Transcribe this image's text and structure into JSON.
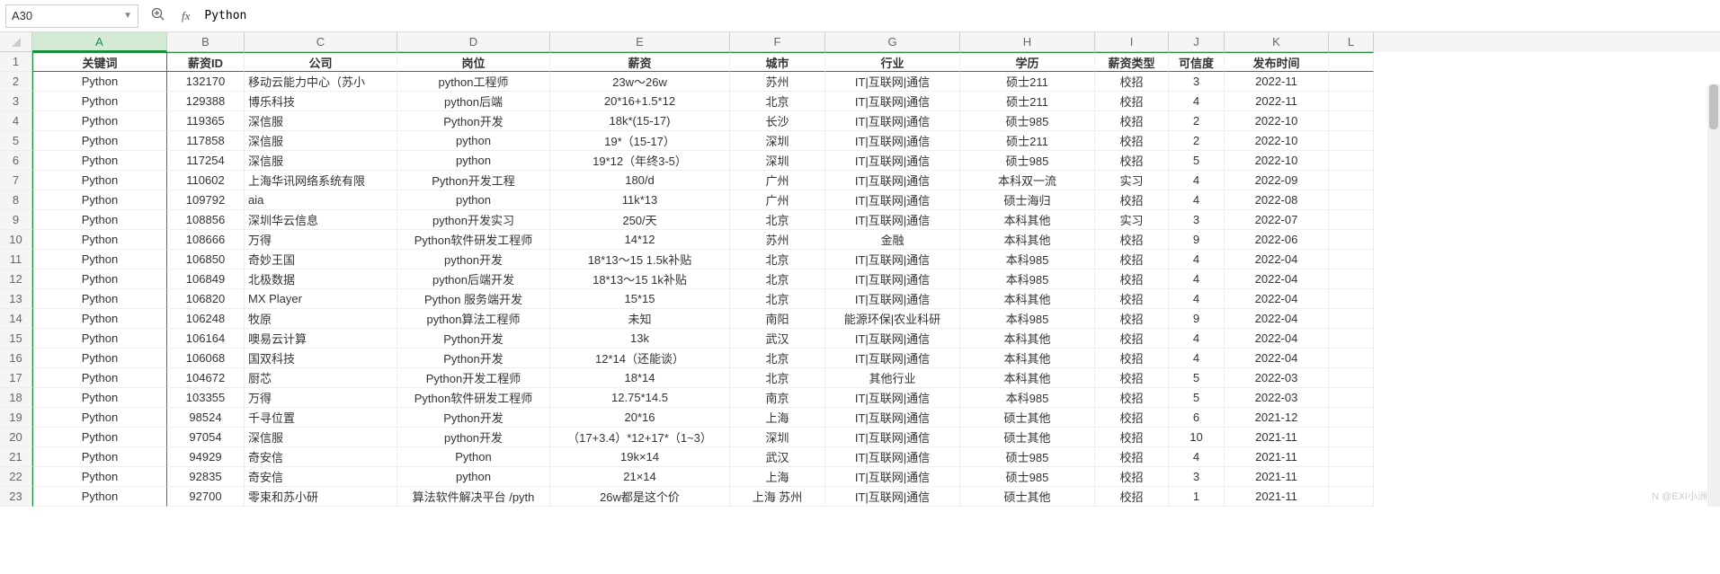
{
  "formula_bar": {
    "cell_ref": "A30",
    "value": "Python"
  },
  "col_letters": [
    "A",
    "B",
    "C",
    "D",
    "E",
    "F",
    "G",
    "H",
    "I",
    "J",
    "K",
    "L"
  ],
  "headers": {
    "A": "关键词",
    "B": "薪资ID",
    "C": "公司",
    "D": "岗位",
    "E": "薪资",
    "F": "城市",
    "G": "行业",
    "H": "学历",
    "I": "薪资类型",
    "J": "可信度",
    "K": "发布时间"
  },
  "rows": [
    {
      "A": "Python",
      "B": "132170",
      "C": "移动云能力中心（苏小",
      "D": "python工程师",
      "E": "23w～26w",
      "F": "苏州",
      "G": "IT|互联网|通信",
      "H": "硕士211",
      "I": "校招",
      "J": "3",
      "K": "2022-11"
    },
    {
      "A": "Python",
      "B": "129388",
      "C": "博乐科技",
      "D": "python后端",
      "E": "20*16+1.5*12",
      "F": "北京",
      "G": "IT|互联网|通信",
      "H": "硕士211",
      "I": "校招",
      "J": "4",
      "K": "2022-11"
    },
    {
      "A": "Python",
      "B": "119365",
      "C": "深信服",
      "D": "Python开发",
      "E": "18k*(15-17)",
      "F": "长沙",
      "G": "IT|互联网|通信",
      "H": "硕士985",
      "I": "校招",
      "J": "2",
      "K": "2022-10"
    },
    {
      "A": "Python",
      "B": "117858",
      "C": "深信服",
      "D": "python",
      "E": "19*（15-17）",
      "F": "深圳",
      "G": "IT|互联网|通信",
      "H": "硕士211",
      "I": "校招",
      "J": "2",
      "K": "2022-10"
    },
    {
      "A": "Python",
      "B": "117254",
      "C": "深信服",
      "D": "python",
      "E": "19*12（年终3-5）",
      "F": "深圳",
      "G": "IT|互联网|通信",
      "H": "硕士985",
      "I": "校招",
      "J": "5",
      "K": "2022-10"
    },
    {
      "A": "Python",
      "B": "110602",
      "C": "上海华讯网络系统有限",
      "D": "Python开发工程",
      "E": "180/d",
      "F": "广州",
      "G": "IT|互联网|通信",
      "H": "本科双一流",
      "I": "实习",
      "J": "4",
      "K": "2022-09"
    },
    {
      "A": "Python",
      "B": "109792",
      "C": "aia",
      "D": "python",
      "E": "11k*13",
      "F": "广州",
      "G": "IT|互联网|通信",
      "H": "硕士海归",
      "I": "校招",
      "J": "4",
      "K": "2022-08"
    },
    {
      "A": "Python",
      "B": "108856",
      "C": "深圳华云信息",
      "D": "python开发实习",
      "E": "250/天",
      "F": "北京",
      "G": "IT|互联网|通信",
      "H": "本科其他",
      "I": "实习",
      "J": "3",
      "K": "2022-07"
    },
    {
      "A": "Python",
      "B": "108666",
      "C": "万得",
      "D": "Python软件研发工程师",
      "E": "14*12",
      "F": "苏州",
      "G": "金融",
      "H": "本科其他",
      "I": "校招",
      "J": "9",
      "K": "2022-06"
    },
    {
      "A": "Python",
      "B": "106850",
      "C": "奇妙王国",
      "D": "python开发",
      "E": "18*13～15 1.5k补贴",
      "F": "北京",
      "G": "IT|互联网|通信",
      "H": "本科985",
      "I": "校招",
      "J": "4",
      "K": "2022-04"
    },
    {
      "A": "Python",
      "B": "106849",
      "C": "北极数据",
      "D": "python后端开发",
      "E": "18*13～15 1k补贴",
      "F": "北京",
      "G": "IT|互联网|通信",
      "H": "本科985",
      "I": "校招",
      "J": "4",
      "K": "2022-04"
    },
    {
      "A": "Python",
      "B": "106820",
      "C": "MX Player",
      "D": "Python 服务端开发",
      "E": "15*15",
      "F": "北京",
      "G": "IT|互联网|通信",
      "H": "本科其他",
      "I": "校招",
      "J": "4",
      "K": "2022-04"
    },
    {
      "A": "Python",
      "B": "106248",
      "C": "牧原",
      "D": "python算法工程师",
      "E": "未知",
      "F": "南阳",
      "G": "能源环保|农业科研",
      "H": "本科985",
      "I": "校招",
      "J": "9",
      "K": "2022-04"
    },
    {
      "A": "Python",
      "B": "106164",
      "C": "噢易云计算",
      "D": "Python开发",
      "E": "13k",
      "F": "武汉",
      "G": "IT|互联网|通信",
      "H": "本科其他",
      "I": "校招",
      "J": "4",
      "K": "2022-04"
    },
    {
      "A": "Python",
      "B": "106068",
      "C": "国双科技",
      "D": "Python开发",
      "E": "12*14（还能谈）",
      "F": "北京",
      "G": "IT|互联网|通信",
      "H": "本科其他",
      "I": "校招",
      "J": "4",
      "K": "2022-04"
    },
    {
      "A": "Python",
      "B": "104672",
      "C": "厨芯",
      "D": "Python开发工程师",
      "E": "18*14",
      "F": "北京",
      "G": "其他行业",
      "H": "本科其他",
      "I": "校招",
      "J": "5",
      "K": "2022-03"
    },
    {
      "A": "Python",
      "B": "103355",
      "C": "万得",
      "D": "Python软件研发工程师",
      "E": "12.75*14.5",
      "F": "南京",
      "G": "IT|互联网|通信",
      "H": "本科985",
      "I": "校招",
      "J": "5",
      "K": "2022-03"
    },
    {
      "A": "Python",
      "B": "98524",
      "C": "千寻位置",
      "D": "Python开发",
      "E": "20*16",
      "F": "上海",
      "G": "IT|互联网|通信",
      "H": "硕士其他",
      "I": "校招",
      "J": "6",
      "K": "2021-12"
    },
    {
      "A": "Python",
      "B": "97054",
      "C": "深信服",
      "D": "python开发",
      "E": "（17+3.4）*12+17*（1~3）",
      "F": "深圳",
      "G": "IT|互联网|通信",
      "H": "硕士其他",
      "I": "校招",
      "J": "10",
      "K": "2021-11"
    },
    {
      "A": "Python",
      "B": "94929",
      "C": "奇安信",
      "D": "Python",
      "E": "19k×14",
      "F": "武汉",
      "G": "IT|互联网|通信",
      "H": "硕士985",
      "I": "校招",
      "J": "4",
      "K": "2021-11"
    },
    {
      "A": "Python",
      "B": "92835",
      "C": "奇安信",
      "D": "python",
      "E": "21×14",
      "F": "上海",
      "G": "IT|互联网|通信",
      "H": "硕士985",
      "I": "校招",
      "J": "3",
      "K": "2021-11"
    },
    {
      "A": "Python",
      "B": "92700",
      "C": "零束和苏小研",
      "D": "算法软件解决平台  /pyth",
      "E": "26w都是这个价",
      "F": "上海 苏州",
      "G": "IT|互联网|通信",
      "H": "硕士其他",
      "I": "校招",
      "J": "1",
      "K": "2021-11"
    }
  ],
  "watermark": "N @EXI小洲"
}
